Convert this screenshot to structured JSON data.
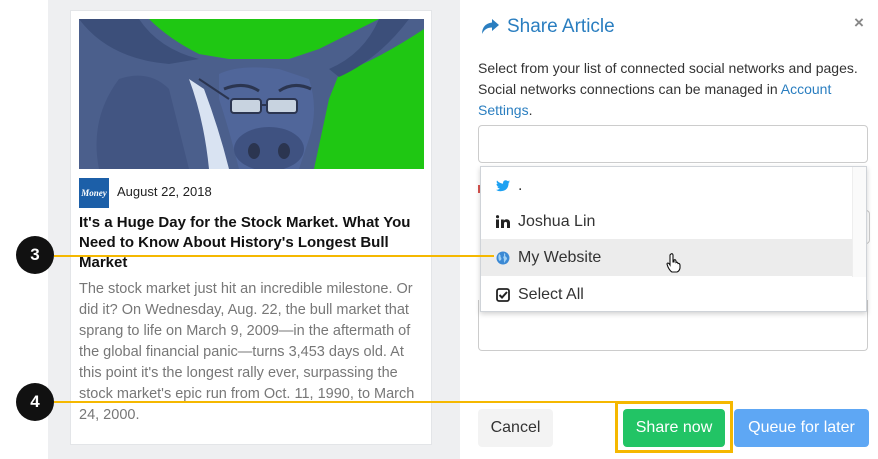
{
  "article": {
    "date": "August 22, 2018",
    "source_logo": "Money",
    "title": "It's a Huge Day for the Stock Market. What You Need to Know About History's Longest Bull Market",
    "body": "The stock market just hit an incredible milestone. Or did it? On Wednesday, Aug. 22, the bull market that sprang to life on March 9, 2009—in the aftermath of the global financial panic—turns 3,453 days old. At this point it's the longest rally ever, surpassing the stock market's epic run from Oct. 11, 1990, to March 24, 2000."
  },
  "panel": {
    "title": "Share Article",
    "close": "×",
    "description": "Select from your list of connected social networks and pages. Social networks connections can be managed in ",
    "link_text": "Account Settings",
    "description_end": ".",
    "profile_input_placeholder": ""
  },
  "dropdown": {
    "items": [
      {
        "label": ".",
        "icon": "twitter-icon"
      },
      {
        "label": "Joshua Lin",
        "icon": "linkedin-icon"
      },
      {
        "label": "My Website",
        "icon": "globe-icon",
        "highlighted": true
      },
      {
        "label": "Select All",
        "icon": "checkbox-icon"
      }
    ]
  },
  "buttons": {
    "cancel": "Cancel",
    "share_now": "Share now",
    "queue_later": "Queue for later"
  },
  "callouts": {
    "step_3": "3",
    "step_4": "4"
  },
  "colors": {
    "accent": "#2a7ec0",
    "share_green": "#22c465",
    "queue_blue": "#5ea7f4",
    "highlight_yellow": "#f5b800",
    "image_green": "#1fc713"
  }
}
